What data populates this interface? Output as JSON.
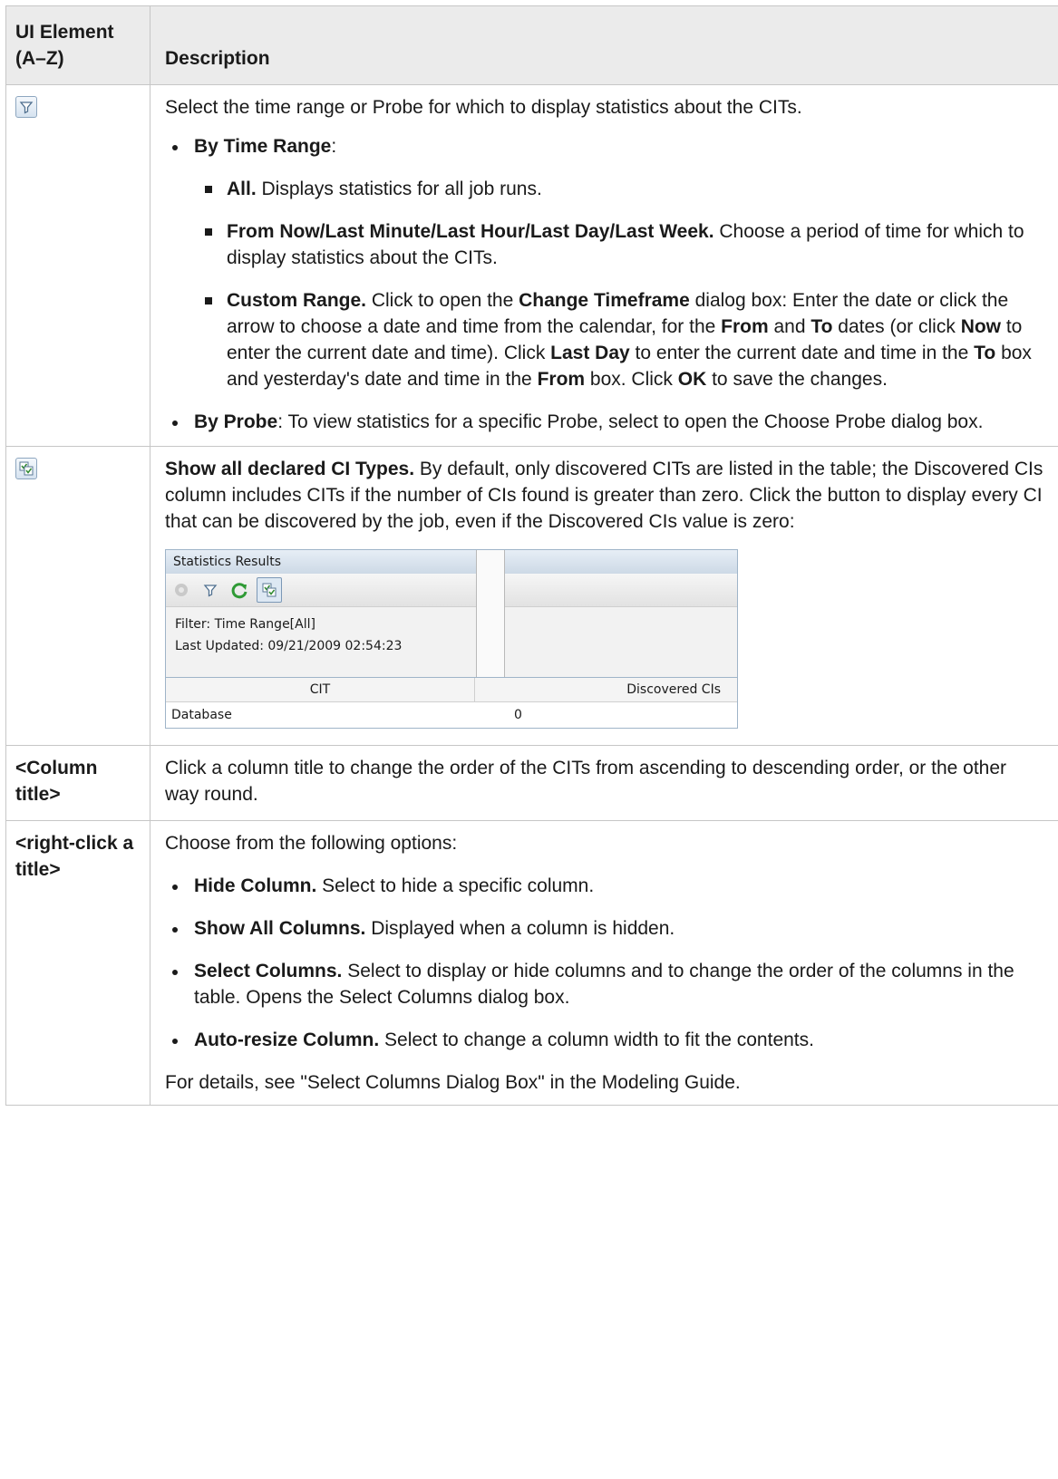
{
  "header": {
    "col_element": "UI Element (A–Z)",
    "col_description": "Description"
  },
  "rows": {
    "filter": {
      "icon": "filter-icon",
      "intro": "Select the time range or Probe for which to display statistics about the CITs.",
      "by_time_range": {
        "label": "By Time Range",
        "tail": ":"
      },
      "all": {
        "label": "All.",
        "text": " Displays statistics for all job runs."
      },
      "from_now": {
        "label": "From Now/Last Minute/Last Hour/Last Day/Last Week.",
        "text": " Choose a period of time for which to display statistics about the CITs."
      },
      "custom": {
        "label": "Custom Range.",
        "t1": " Click to open the ",
        "b1": "Change Timeframe",
        "t2": " dialog box: Enter the date or click the arrow to choose a date and time from the calendar, for the ",
        "b2": "From",
        "t3": " and ",
        "b3": "To",
        "t4": " dates (or click ",
        "b4": "Now",
        "t5": " to enter the current date and time). Click ",
        "b5": "Last Day",
        "t6": " to enter the current date and time in the ",
        "b6": "To",
        "t7": " box and yesterday's date and time in the ",
        "b7": "From",
        "t8": " box. Click ",
        "b8": "OK",
        "t9": " to save the changes."
      },
      "by_probe": {
        "label": "By Probe",
        "text": ": To view statistics for a specific Probe, select to open the Choose Probe dialog box."
      }
    },
    "show_all": {
      "icon": "show-all-ci-types-icon",
      "label": "Show all declared CI Types.",
      "text": " By default, only discovered CITs are listed in the table; the Discovered CIs column includes CITs if the number of CIs found is greater than zero. Click the button to display every CI that can be discovered by the job, even if the Discovered CIs value is zero:",
      "screenshot": {
        "title": "Statistics Results",
        "filter_line": "Filter: Time Range[All]",
        "updated_line": "Last Updated: 09/21/2009 02:54:23",
        "columns": [
          "CIT",
          "Discovered CIs"
        ],
        "row": {
          "cit": "Database",
          "count": "0"
        }
      }
    },
    "column_title": {
      "element": "<Column title>",
      "text": "Click a column title to change the order of the CITs from ascending to descending order, or the other way round."
    },
    "right_click": {
      "element": "<right-click a title>",
      "intro": "Choose from the following options:",
      "items": [
        {
          "label": "Hide Column.",
          "text": " Select to hide a specific column."
        },
        {
          "label": "Show All Columns.",
          "text": " Displayed when a column is hidden."
        },
        {
          "label": "Select Columns.",
          "text": " Select to display or hide columns and to change the order of the columns in the table. Opens the Select Columns dialog box."
        },
        {
          "label": "Auto-resize Column.",
          "text": " Select to change a column width to fit the contents."
        }
      ],
      "footer": "For details, see \"Select Columns Dialog Box\" in the Modeling Guide."
    }
  }
}
